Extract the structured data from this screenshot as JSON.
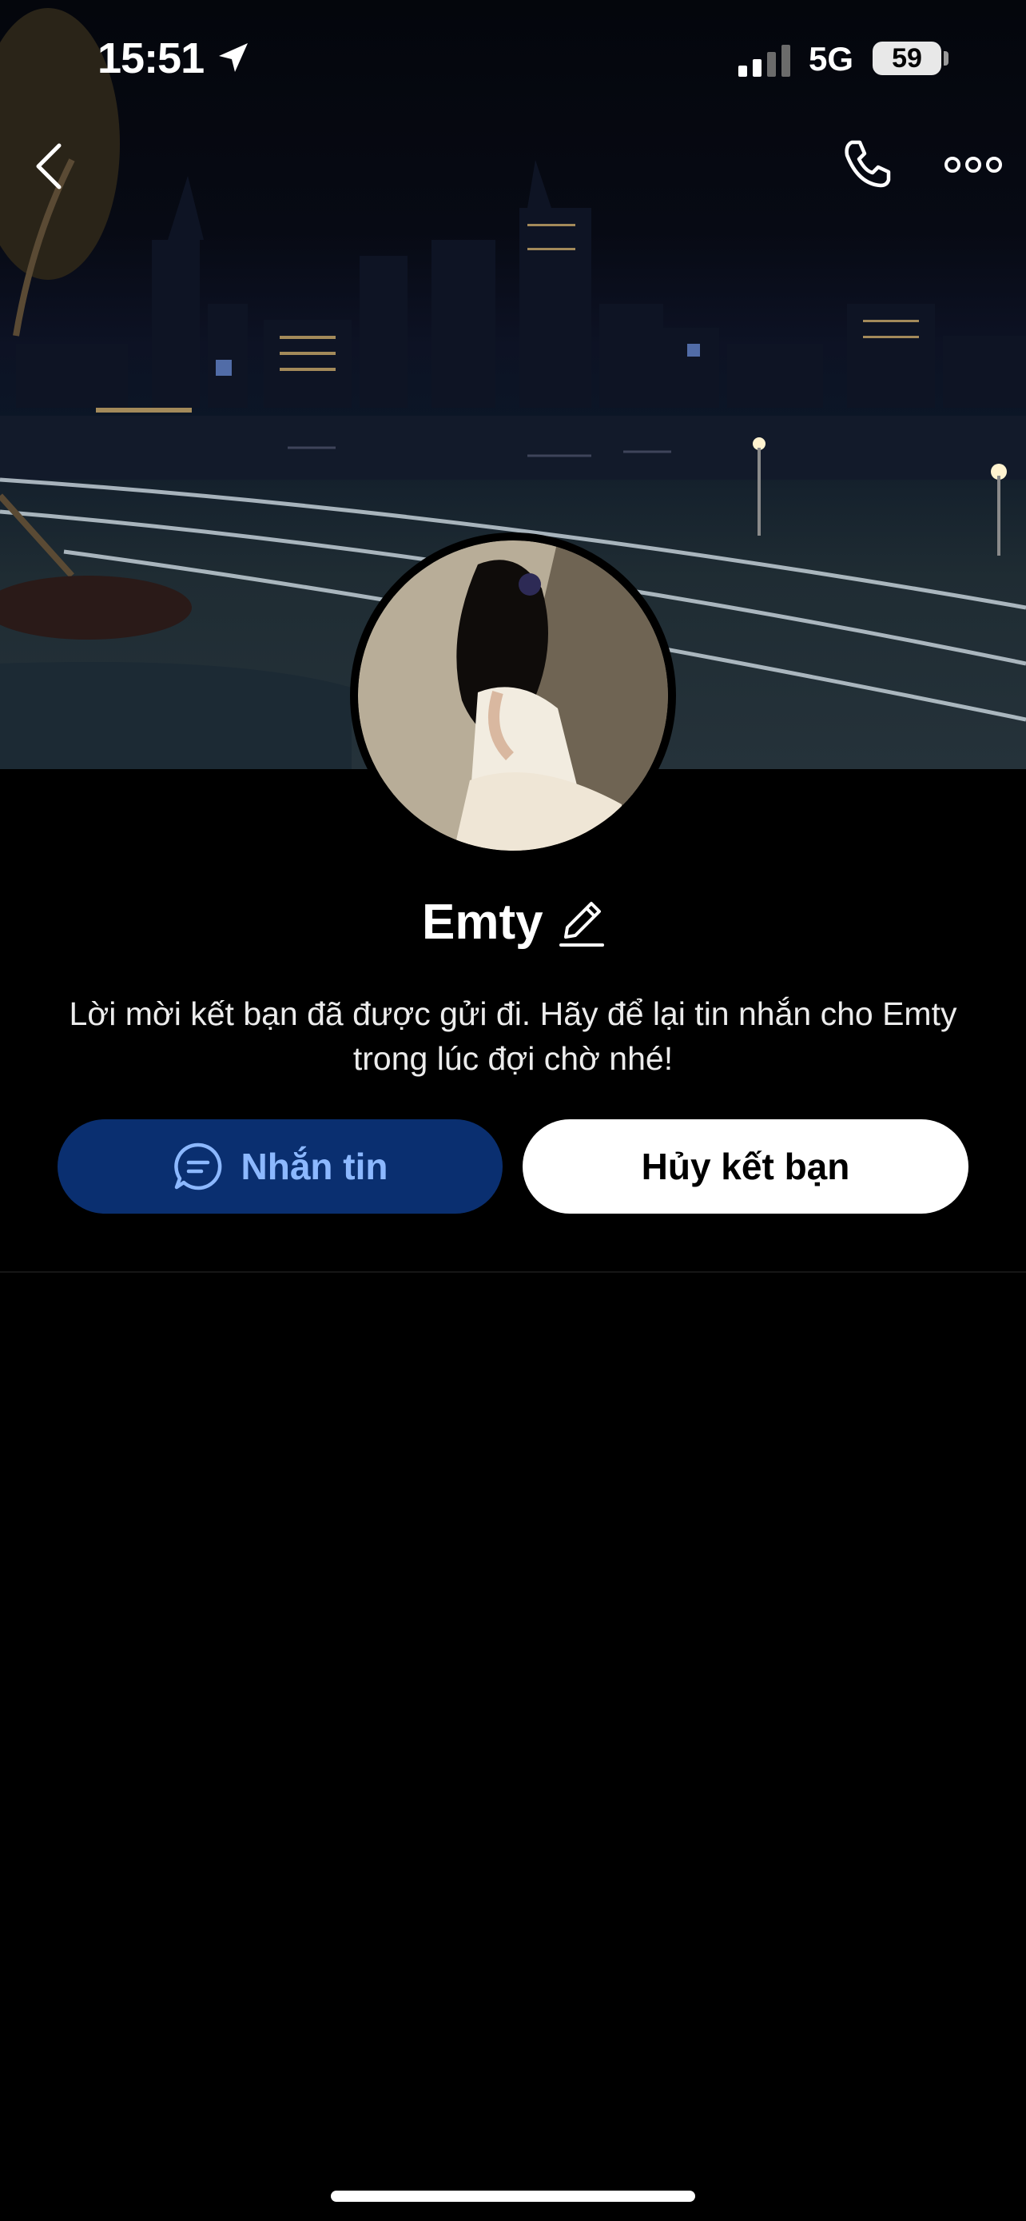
{
  "status_bar": {
    "time": "15:51",
    "network": "5G",
    "battery": "59"
  },
  "header": {
    "back_icon": "chevron-left-icon",
    "call_icon": "phone-icon",
    "more_icon": "more-dots-icon"
  },
  "profile": {
    "name": "Emty",
    "edit_icon": "pencil-icon",
    "description": "Lời mời kết bạn đã được gửi đi. Hãy để lại tin nhắn cho Emty trong lúc đợi chờ nhé!"
  },
  "actions": {
    "message_label": "Nhắn tin",
    "message_icon": "chat-bubble-icon",
    "unfriend_label": "Hủy kết bạn"
  },
  "colors": {
    "message_button_bg": "#0a2f70",
    "message_button_text": "#8cb8ff",
    "unfriend_button_bg": "#ffffff",
    "background": "#000000"
  }
}
